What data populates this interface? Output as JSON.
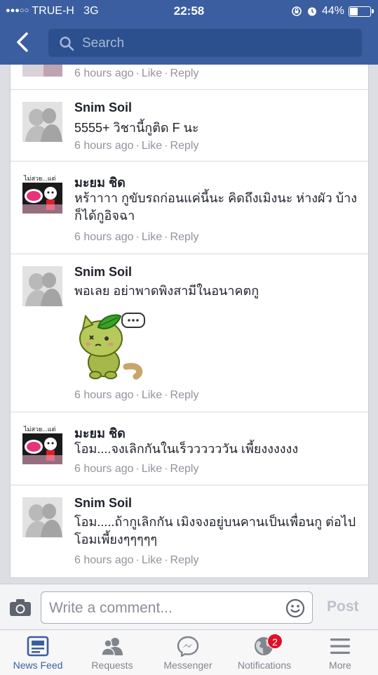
{
  "status_bar": {
    "carrier": "TRUE-H",
    "network": "3G",
    "time": "22:58",
    "battery": "44%",
    "battery_level": 0.44
  },
  "header": {
    "search_placeholder": "Search"
  },
  "comments": [
    {
      "author": "",
      "text": "",
      "time": "6 hours ago",
      "like_label": "Like",
      "reply_label": "Reply",
      "avatar": "partial"
    },
    {
      "author": "Snim Soil",
      "text": "5555+ วิชานี้กูติด F นะ",
      "time": "6 hours ago",
      "like_label": "Like",
      "reply_label": "Reply",
      "avatar": "photo"
    },
    {
      "author": "มะยม ชิด",
      "text": "หร้าาาา  กูขับรถก่อนแค่นี้นะ คิดถึงเมิงนะ ห่างผัว บ้างก็ได้กูอิจฉา",
      "time": "6 hours ago",
      "like_label": "Like",
      "reply_label": "Reply",
      "avatar": "cartoon",
      "avatar_text": "ไม่สวย...แต่"
    },
    {
      "author": "Snim Soil",
      "text": "พอเลย อย่าพาดพิงสามีในอนาคตกู",
      "time": "6 hours ago",
      "like_label": "Like",
      "reply_label": "Reply",
      "avatar": "photo",
      "sticker": "leaf-cat-sticker"
    },
    {
      "author": "มะยม ชิด",
      "text": "โอม....จงเลิกกันในเร็ววววววัน เพี้ยงงงงงง",
      "time": "6 hours ago",
      "like_label": "Like",
      "reply_label": "Reply",
      "avatar": "cartoon",
      "avatar_text": "ไม่สวย...แต่"
    },
    {
      "author": "Snim Soil",
      "text": "โอม.....ถ้ากูเลิกกัน เมิงจงอยู่บนคานเป็นเพื่อนกู ต่อไป โอมเพี้ยงๆๆๆๆๆ",
      "time": "6 hours ago",
      "like_label": "Like",
      "reply_label": "Reply",
      "avatar": "photo"
    }
  ],
  "composer": {
    "placeholder": "Write a comment...",
    "post_label": "Post"
  },
  "tabs": [
    {
      "label": "News Feed",
      "icon": "news-feed-icon",
      "active": true
    },
    {
      "label": "Requests",
      "icon": "friend-requests-icon"
    },
    {
      "label": "Messenger",
      "icon": "messenger-icon"
    },
    {
      "label": "Notifications",
      "icon": "globe-icon",
      "badge": "2"
    },
    {
      "label": "More",
      "icon": "hamburger-menu-icon"
    }
  ],
  "colors": {
    "brand": "#3b5ea0",
    "badge": "#e0102a"
  }
}
